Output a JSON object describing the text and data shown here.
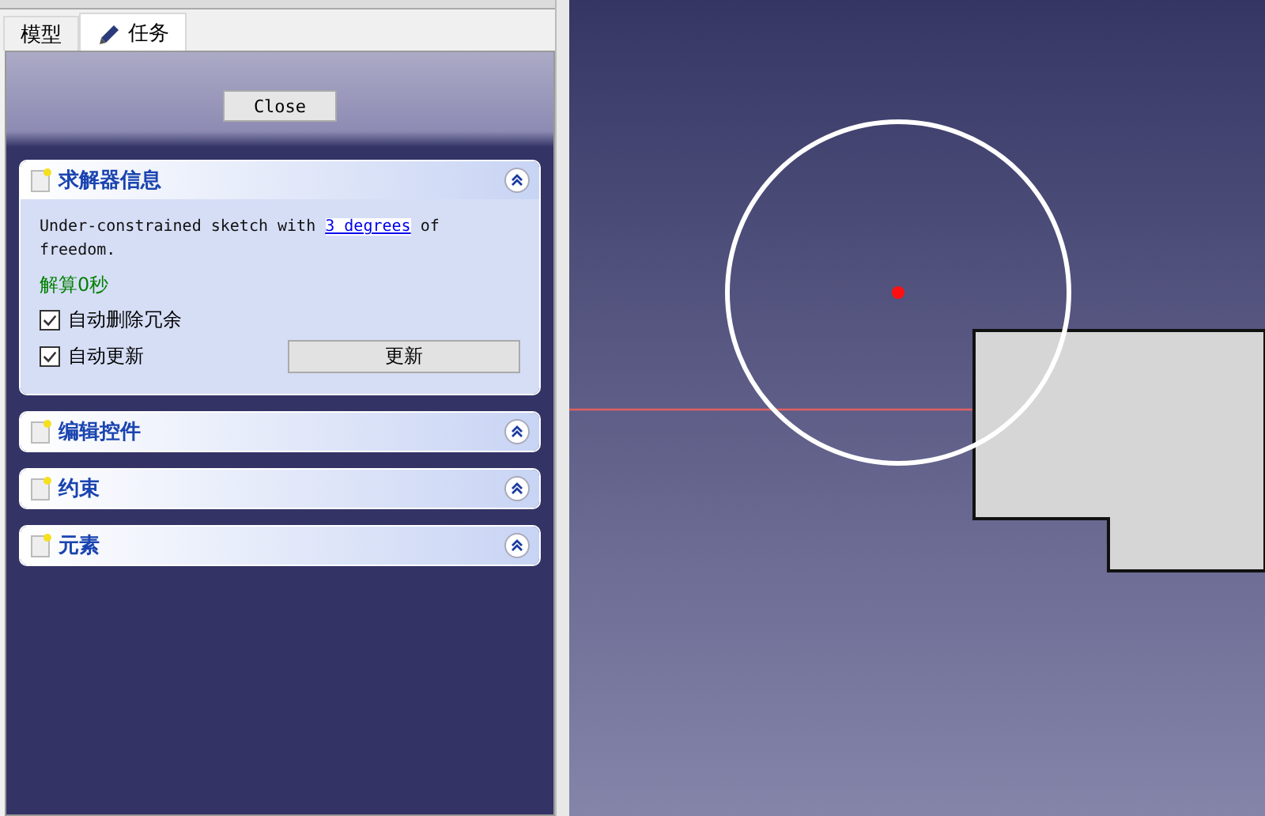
{
  "tabs": [
    {
      "label": "模型",
      "selected": false,
      "kind": "plain"
    },
    {
      "label": "任务",
      "selected": true,
      "kind": "pencil"
    }
  ],
  "close_button": "Close",
  "panels": [
    {
      "title": "求解器信息",
      "expanded": true,
      "message": {
        "before": "Under-constrained sketch with ",
        "link": "3 degrees",
        "after": " of freedom."
      },
      "solve_time": "解算0秒",
      "options": [
        {
          "label": "自动删除冗余",
          "checked": true
        },
        {
          "label": "自动更新",
          "checked": true
        }
      ],
      "update_button": "更新"
    },
    {
      "title": "编辑控件",
      "expanded": true
    },
    {
      "title": "约束",
      "expanded": true
    },
    {
      "title": "元素",
      "expanded": true
    }
  ]
}
